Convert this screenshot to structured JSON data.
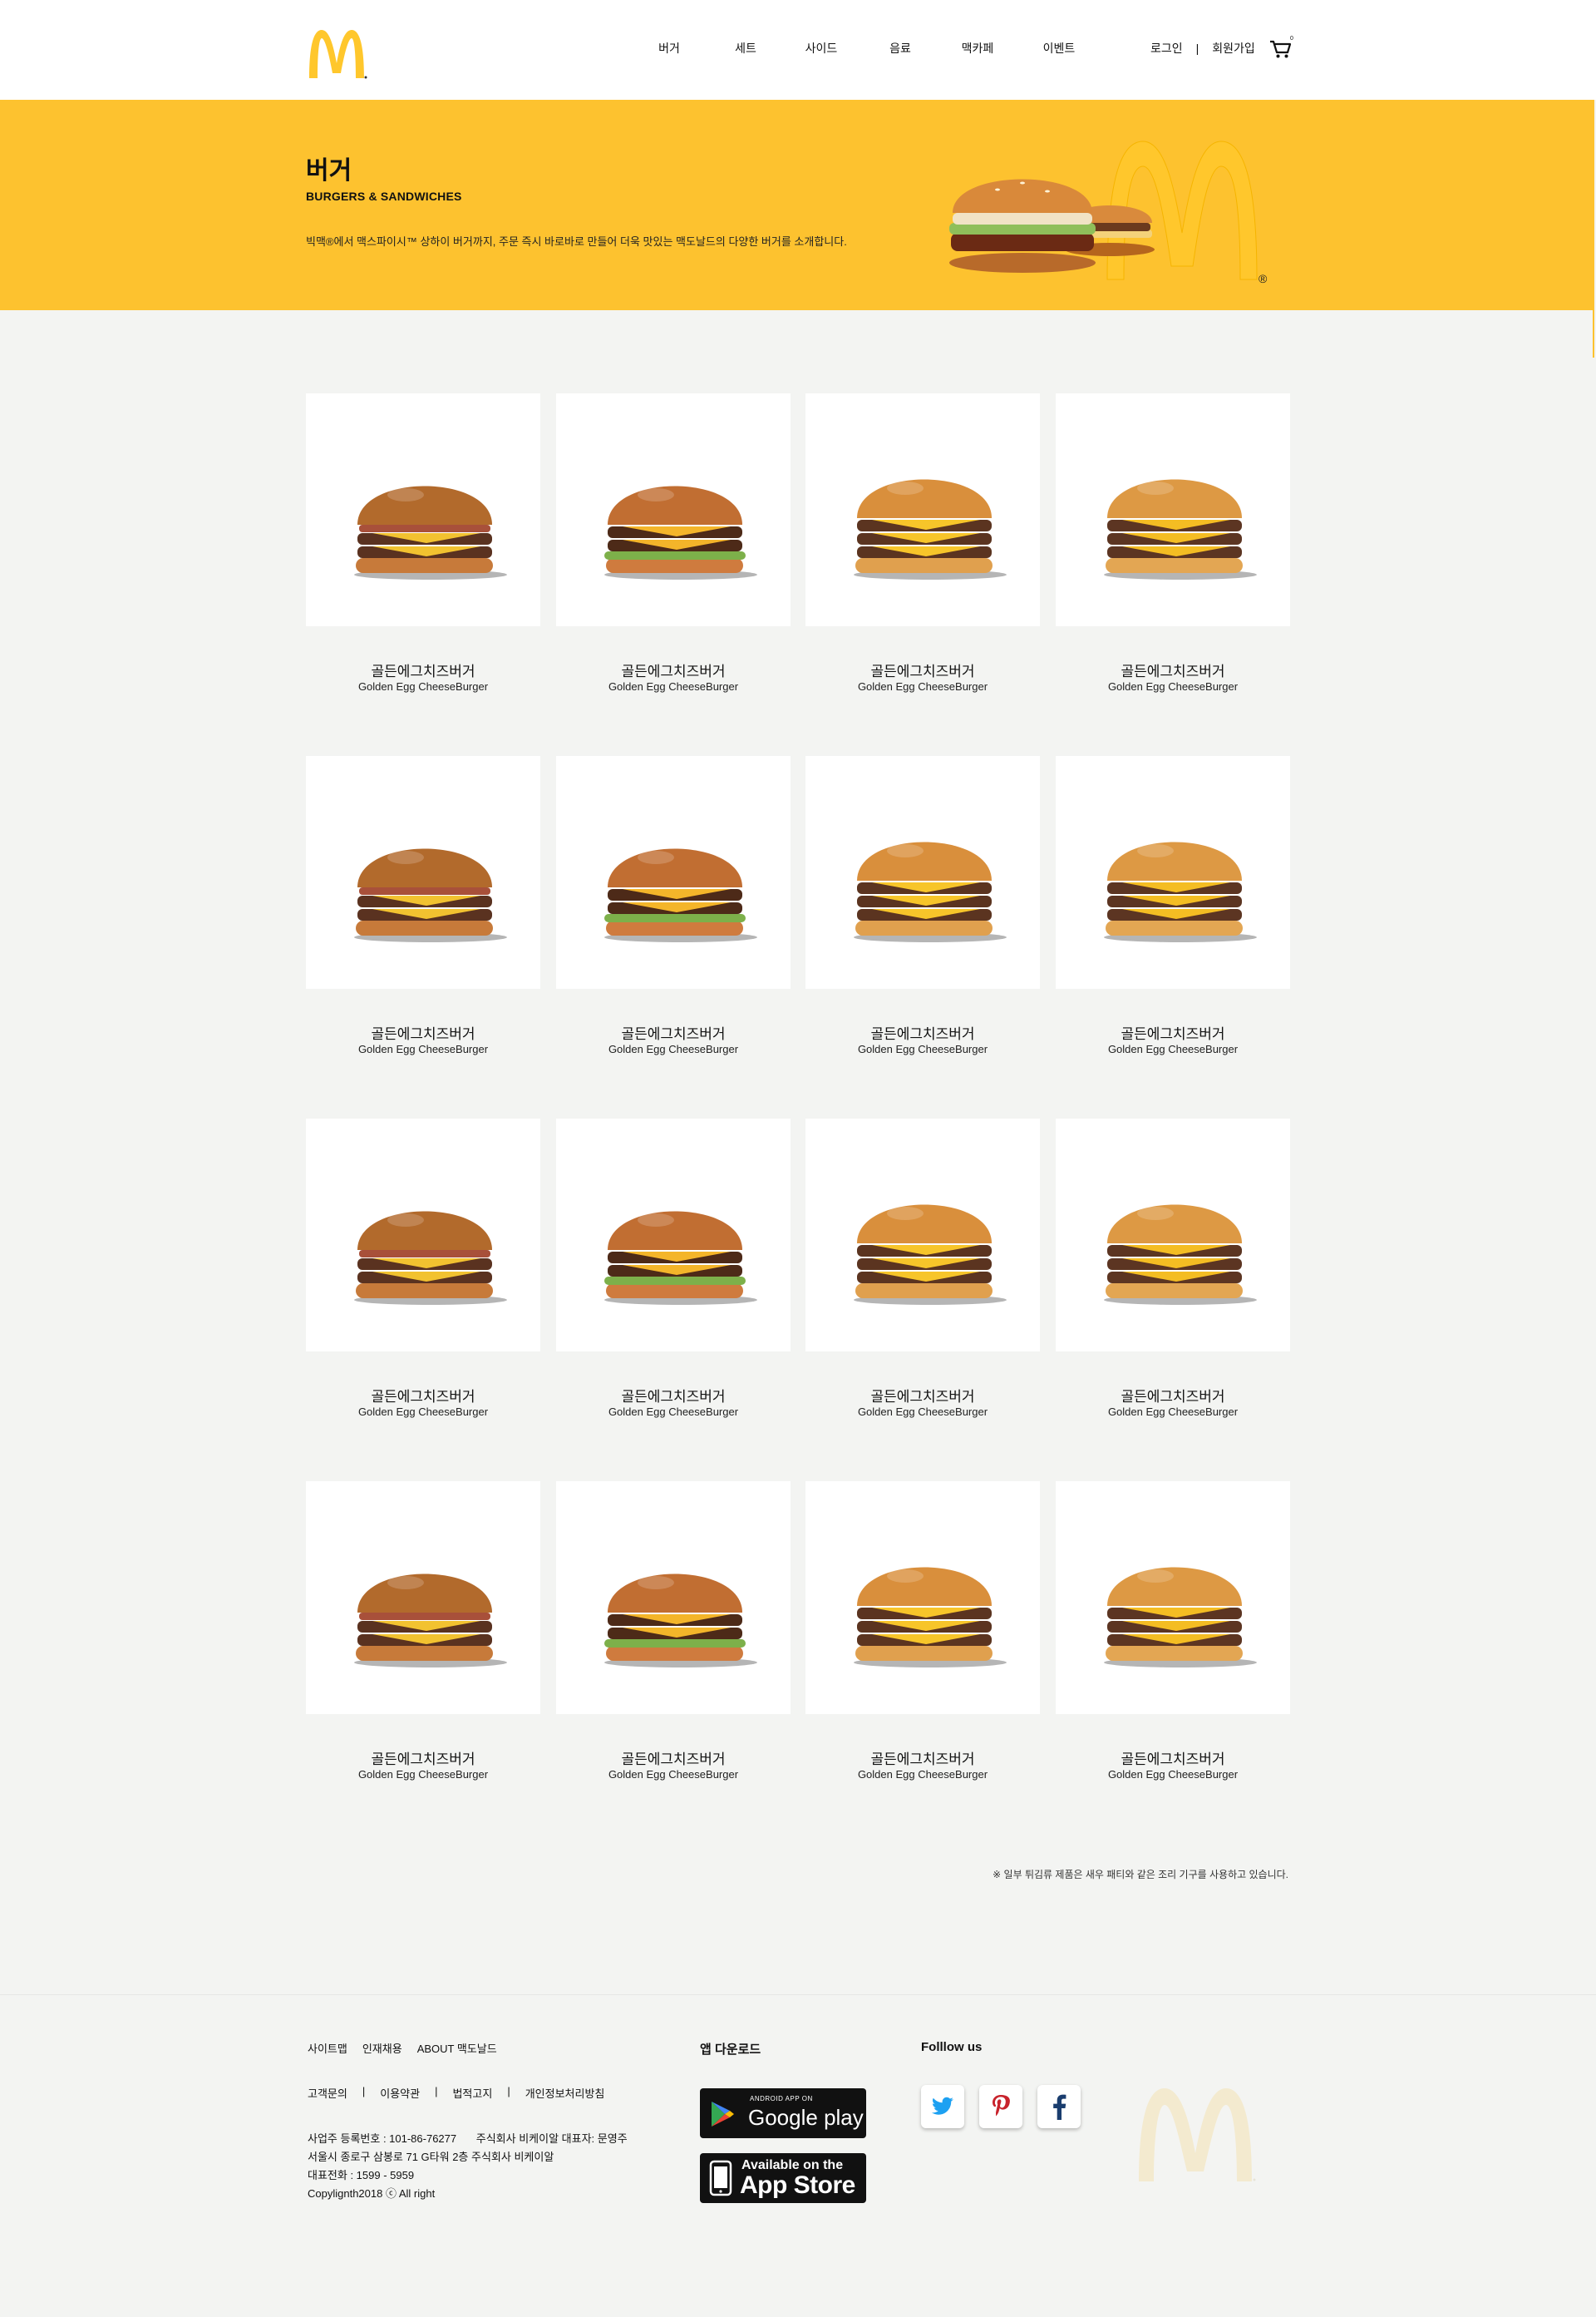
{
  "header": {
    "nav": [
      "버거",
      "세트",
      "사이드",
      "음료",
      "맥카페",
      "이벤트"
    ],
    "login": "로그인",
    "separator": "|",
    "signup": "회원가입",
    "cart_count": "0"
  },
  "hero": {
    "title": "버거",
    "subtitle": "BURGERS & SANDWICHES",
    "description": "빅맥®에서 맥스파이시™ 상하이 버거까지, 주문 즉시 바로바로 만들어 더욱 맛있는 맥도날드의 다양한 버거를 소개합니다."
  },
  "products": [
    {
      "name_ko": "골든에그치즈버거",
      "name_en": "Golden Egg CheeseBurger"
    },
    {
      "name_ko": "골든에그치즈버거",
      "name_en": "Golden Egg CheeseBurger"
    },
    {
      "name_ko": "골든에그치즈버거",
      "name_en": "Golden Egg CheeseBurger"
    },
    {
      "name_ko": "골든에그치즈버거",
      "name_en": "Golden Egg CheeseBurger"
    },
    {
      "name_ko": "골든에그치즈버거",
      "name_en": "Golden Egg CheeseBurger"
    },
    {
      "name_ko": "골든에그치즈버거",
      "name_en": "Golden Egg CheeseBurger"
    },
    {
      "name_ko": "골든에그치즈버거",
      "name_en": "Golden Egg CheeseBurger"
    },
    {
      "name_ko": "골든에그치즈버거",
      "name_en": "Golden Egg CheeseBurger"
    },
    {
      "name_ko": "골든에그치즈버거",
      "name_en": "Golden Egg CheeseBurger"
    },
    {
      "name_ko": "골든에그치즈버거",
      "name_en": "Golden Egg CheeseBurger"
    },
    {
      "name_ko": "골든에그치즈버거",
      "name_en": "Golden Egg CheeseBurger"
    },
    {
      "name_ko": "골든에그치즈버거",
      "name_en": "Golden Egg CheeseBurger"
    },
    {
      "name_ko": "골든에그치즈버거",
      "name_en": "Golden Egg CheeseBurger"
    },
    {
      "name_ko": "골든에그치즈버거",
      "name_en": "Golden Egg CheeseBurger"
    },
    {
      "name_ko": "골든에그치즈버거",
      "name_en": "Golden Egg CheeseBurger"
    },
    {
      "name_ko": "골든에그치즈버거",
      "name_en": "Golden Egg CheeseBurger"
    }
  ],
  "note": "※ 일부 튀김류 제품은 새우 패티와 같은 조리 기구를 사용하고 있습니다.",
  "footer": {
    "links1": [
      "사이트맵",
      "인재채용",
      "ABOUT 맥도날드"
    ],
    "links2": [
      "고객문의",
      "이용약관",
      "법적고지",
      "개인정보처리방침"
    ],
    "separator": "|",
    "biz_no": "사업주 등록번호 : 101-86-76277",
    "company": "주식회사 비케이알 대표자: 문영주",
    "address": "서울시 종로구 삼봉로 71 G타워 2층 주식회사 비케이알",
    "phone": "대표전화 : 1599 - 5959",
    "copyright": "Copylignth2018 ⓒ All right",
    "app_title": "앱 다운로드",
    "google_small": "ANDROID APP ON",
    "google_big": "Google play",
    "apple_small": "Available on the",
    "apple_big": "App Store",
    "follow_title": "Folllow us",
    "social_icons": [
      "twitter-icon",
      "pinterest-icon",
      "facebook-icon"
    ]
  },
  "colors": {
    "brand_yellow": "#fdc22f",
    "logo_yellow": "#ffc72c"
  }
}
